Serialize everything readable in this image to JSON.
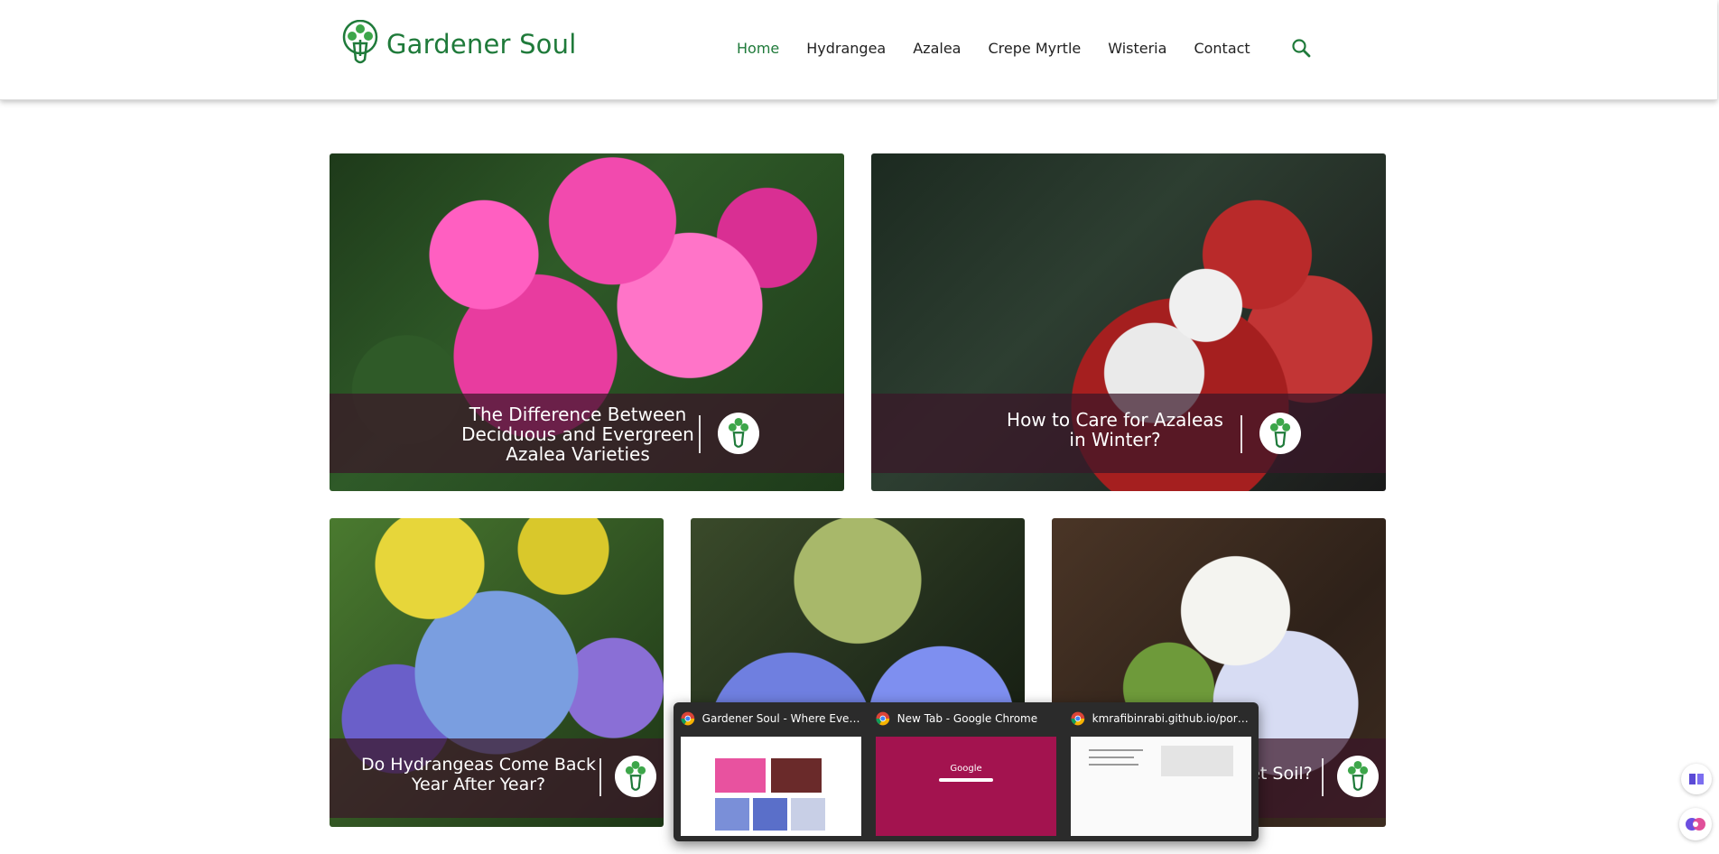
{
  "brand": {
    "name": "Gardener Soul",
    "color": "#1f7a3a"
  },
  "nav": {
    "items": [
      "Home",
      "Hydrangea",
      "Azalea",
      "Crepe Myrtle",
      "Wisteria",
      "Contact"
    ],
    "active": "Home"
  },
  "search": {
    "icon": "search-icon"
  },
  "cards": [
    {
      "title": "The Difference Between Deciduous and Evergreen Azalea Varieties",
      "image": "pink azalea flowers"
    },
    {
      "title": "How to Care for Azaleas in Winter?",
      "image": "red leaves with snow"
    },
    {
      "title": "Do Hydrangeas Come Back Year After Year?",
      "image": "blue hydrangea and goldenrod"
    },
    {
      "title": "",
      "image": "lacecap hydrangea with dew"
    },
    {
      "title": "et Soil?",
      "image": "white hydrangea on soil"
    }
  ],
  "taskbar_preview": {
    "windows": [
      {
        "title": "Gardener Soul - Where Every Ga...",
        "icon": "chrome-icon"
      },
      {
        "title": "New Tab - Google Chrome",
        "icon": "chrome-icon",
        "thumb_text": "Google"
      },
      {
        "title": "kmrafibinrabi.github.io/portfoli...",
        "icon": "chrome-icon"
      }
    ]
  },
  "side_buttons": [
    {
      "icon": "book-icon"
    },
    {
      "icon": "brain-icon"
    }
  ]
}
